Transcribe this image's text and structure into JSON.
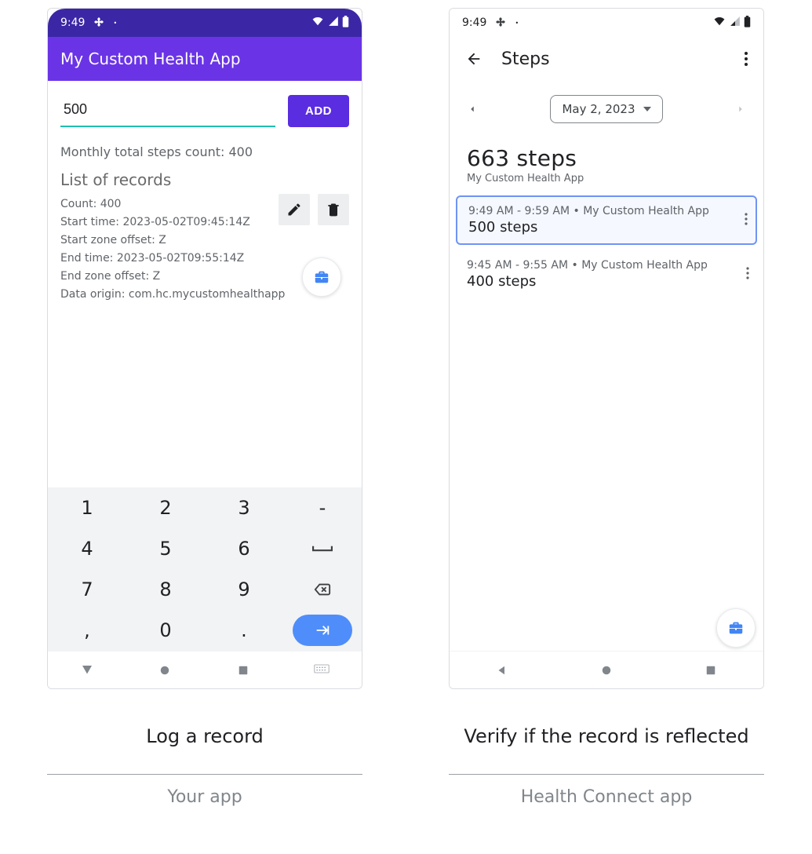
{
  "status": {
    "time": "9:49"
  },
  "left": {
    "app_title": "My Custom Health App",
    "input_value": "500",
    "add_label": "ADD",
    "monthly_label": "Monthly total steps count: 400",
    "list_header": "List of records",
    "record": {
      "count": "Count: 400",
      "start_time": "Start time: 2023-05-02T09:45:14Z",
      "start_zone": "Start zone offset: Z",
      "end_time": "End time: 2023-05-02T09:55:14Z",
      "end_zone": "End zone offset: Z",
      "origin": "Data origin: com.hc.mycustomhealthapp"
    },
    "keyboard": {
      "keys": [
        "1",
        "2",
        "3",
        "-",
        "4",
        "5",
        "6",
        "␣",
        "7",
        "8",
        "9",
        "⌫",
        ",",
        "0",
        ".",
        "→"
      ]
    },
    "caption1": "Log a record",
    "caption2": "Your app"
  },
  "right": {
    "title": "Steps",
    "date": "May 2, 2023",
    "total": "663 steps",
    "total_sub": "My Custom Health App",
    "entries": [
      {
        "meta": "9:49 AM - 9:59 AM • My Custom Health App",
        "value": "500 steps",
        "selected": true
      },
      {
        "meta": "9:45 AM - 9:55 AM • My Custom Health App",
        "value": "400 steps",
        "selected": false
      }
    ],
    "caption1": "Verify if the record is reflected",
    "caption2": "Health Connect app"
  }
}
